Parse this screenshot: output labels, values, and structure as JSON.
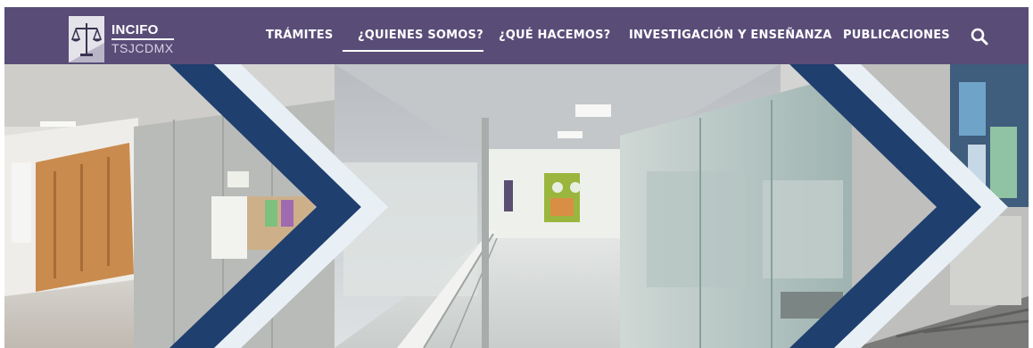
{
  "brand": {
    "name": "INCIFO",
    "subtitle": "TSJCDMX"
  },
  "nav": {
    "items": [
      {
        "label": "TRÁMITES"
      },
      {
        "label": "¿QUIENES SOMOS?",
        "active": true
      },
      {
        "label": "¿QUÉ HACEMOS?"
      },
      {
        "label": "INVESTIGACIÓN Y ENSEÑANZA"
      },
      {
        "label": "PUBLICACIONES"
      }
    ],
    "search_icon": "search-icon"
  },
  "colors": {
    "navbar": "#594d78",
    "chevron_dark": "#1f3f6e",
    "chevron_light": "#e8f0f6"
  }
}
